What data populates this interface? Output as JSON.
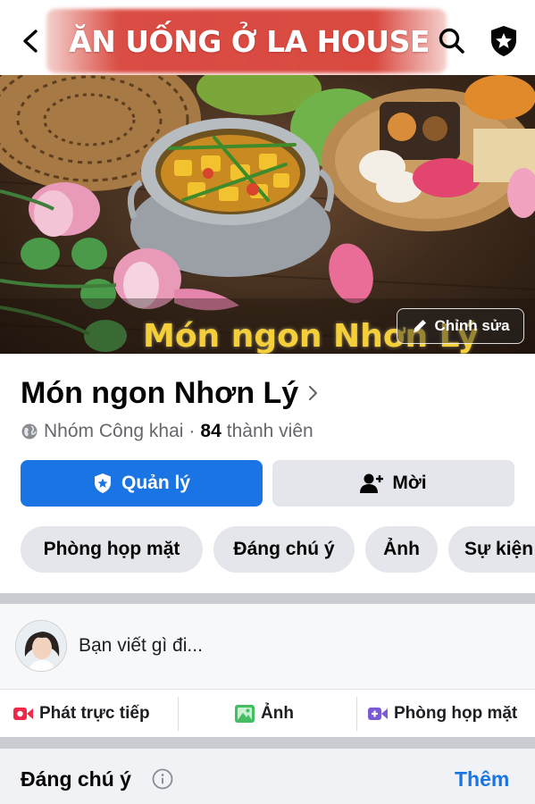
{
  "header": {
    "banner_title": "ĂN UỐNG Ở LA HOUSE",
    "back_icon": "chevron-left-icon",
    "search_icon": "search-icon",
    "admin_icon": "shield-star-icon"
  },
  "cover": {
    "caption": "Món ngon Nhơn Lý",
    "edit_label": "Chỉnh sửa"
  },
  "group": {
    "name": "Món ngon Nhơn Lý",
    "privacy": "Nhóm Công khai",
    "separator": "·",
    "member_count": "84",
    "member_label": "thành viên"
  },
  "actions": {
    "manage_label": "Quản lý",
    "invite_label": "Mời"
  },
  "tabs": [
    {
      "label": "Phòng họp mặt"
    },
    {
      "label": "Đáng chú ý"
    },
    {
      "label": "Ảnh"
    },
    {
      "label": "Sự kiện"
    }
  ],
  "composer": {
    "placeholder": "Bạn viết gì đi..."
  },
  "post_actions": [
    {
      "label": "Phát trực tiếp",
      "icon": "live-video-icon",
      "color": "#f02849"
    },
    {
      "label": "Ảnh",
      "icon": "photo-icon",
      "color": "#45bd62"
    },
    {
      "label": "Phòng họp mặt",
      "icon": "room-video-icon",
      "color": "#7b5ad6"
    }
  ],
  "featured": {
    "title": "Đáng chú ý",
    "more_label": "Thêm"
  },
  "colors": {
    "primary": "#1b74e4",
    "banner_red": "#d63a30",
    "caption_yellow": "#f4cf3a"
  }
}
